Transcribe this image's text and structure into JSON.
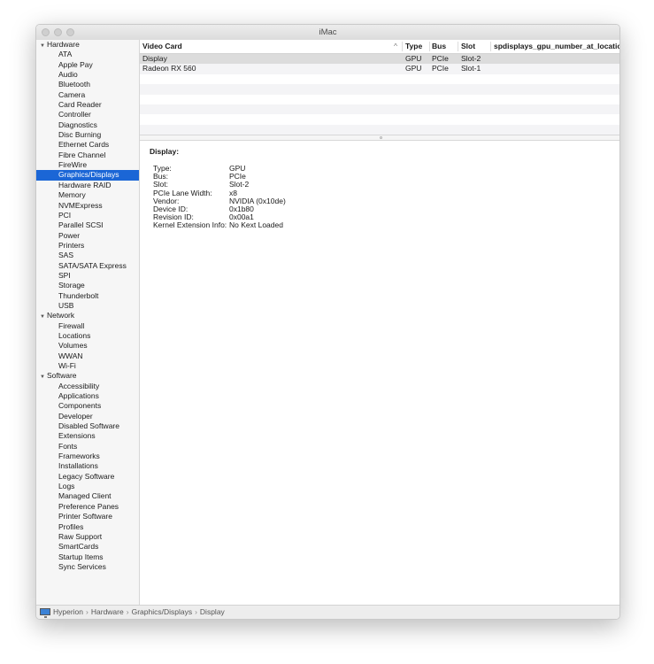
{
  "window": {
    "title": "iMac"
  },
  "sidebar": {
    "groups": [
      {
        "label": "Hardware",
        "items": [
          "ATA",
          "Apple Pay",
          "Audio",
          "Bluetooth",
          "Camera",
          "Card Reader",
          "Controller",
          "Diagnostics",
          "Disc Burning",
          "Ethernet Cards",
          "Fibre Channel",
          "FireWire",
          "Graphics/Displays",
          "Hardware RAID",
          "Memory",
          "NVMExpress",
          "PCI",
          "Parallel SCSI",
          "Power",
          "Printers",
          "SAS",
          "SATA/SATA Express",
          "SPI",
          "Storage",
          "Thunderbolt",
          "USB"
        ]
      },
      {
        "label": "Network",
        "items": [
          "Firewall",
          "Locations",
          "Volumes",
          "WWAN",
          "Wi-Fi"
        ]
      },
      {
        "label": "Software",
        "items": [
          "Accessibility",
          "Applications",
          "Components",
          "Developer",
          "Disabled Software",
          "Extensions",
          "Fonts",
          "Frameworks",
          "Installations",
          "Legacy Software",
          "Logs",
          "Managed Client",
          "Preference Panes",
          "Printer Software",
          "Profiles",
          "Raw Support",
          "SmartCards",
          "Startup Items",
          "Sync Services"
        ]
      }
    ],
    "selected": "Graphics/Displays"
  },
  "table": {
    "columns": [
      "Video Card",
      "Type",
      "Bus",
      "Slot",
      "spdisplays_gpu_number_at_location"
    ],
    "sort_indicator": "^",
    "rows": [
      [
        "Display",
        "GPU",
        "PCIe",
        "Slot-2",
        ""
      ],
      [
        "Radeon RX 560",
        "GPU",
        "PCIe",
        "Slot-1",
        ""
      ]
    ],
    "selected_row": 0
  },
  "detail": {
    "title": "Display:",
    "fields": [
      {
        "key": "Type:",
        "value": "GPU"
      },
      {
        "key": "Bus:",
        "value": "PCIe"
      },
      {
        "key": "Slot:",
        "value": "Slot-2"
      },
      {
        "key": "PCIe Lane Width:",
        "value": "x8"
      },
      {
        "key": "Vendor:",
        "value": "NVIDIA (0x10de)"
      },
      {
        "key": "Device ID:",
        "value": "0x1b80"
      },
      {
        "key": "Revision ID:",
        "value": "0x00a1"
      },
      {
        "key": "Kernel Extension Info:",
        "value": "No Kext Loaded"
      }
    ]
  },
  "statusbar": {
    "icon": "imac-icon",
    "path": [
      "Hyperion",
      "Hardware",
      "Graphics/Displays",
      "Display"
    ],
    "separator": "›"
  }
}
